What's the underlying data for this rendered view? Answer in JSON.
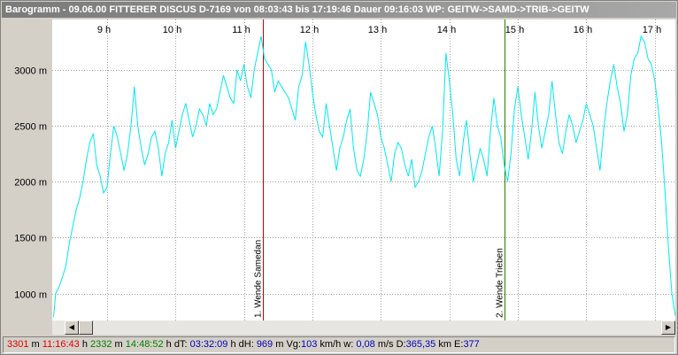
{
  "window": {
    "title": "Barogramm - 09.06.00 FITTERER DISCUS D-7169 von 08:03:43 bis 17:19:46 Dauer 09:16:03 WP: GEITW->SAMD->TRIB->GEITW"
  },
  "colors": {
    "trace": "#00e8ee",
    "marker1": "#cc0000",
    "marker2": "#2e7d00",
    "grid": "#a0a0a0",
    "plot_bg": "#ffffff"
  },
  "chart_data": {
    "type": "line",
    "title": "",
    "xlabel": "",
    "ylabel": "",
    "xlim": [
      8.2,
      17.3
    ],
    "ylim": [
      760,
      3450
    ],
    "x_ticks": [
      9,
      10,
      11,
      12,
      13,
      14,
      15,
      16,
      17
    ],
    "x_tick_labels": [
      "9 h",
      "10 h",
      "11 h",
      "12 h",
      "13 h",
      "14 h",
      "15 h",
      "16 h",
      "17 h"
    ],
    "y_ticks": [
      1000,
      1500,
      2000,
      2500,
      3000
    ],
    "y_tick_labels": [
      "1000 m",
      "1500 m",
      "2000 m",
      "2500 m",
      "3000 m"
    ],
    "grid": true,
    "series": [
      {
        "x": [
          8.22,
          8.25,
          8.3,
          8.35,
          8.4,
          8.45,
          8.5,
          8.55,
          8.6,
          8.65,
          8.7,
          8.75,
          8.8,
          8.85,
          8.9,
          8.95,
          9.0,
          9.05,
          9.1,
          9.15,
          9.2,
          9.25,
          9.3,
          9.35,
          9.4,
          9.45,
          9.5,
          9.55,
          9.6,
          9.65,
          9.7,
          9.75,
          9.8,
          9.85,
          9.9,
          9.95,
          10.0,
          10.05,
          10.1,
          10.15,
          10.2,
          10.25,
          10.3,
          10.35,
          10.4,
          10.45,
          10.5,
          10.55,
          10.6,
          10.65,
          10.7,
          10.75,
          10.8,
          10.85,
          10.9,
          10.95,
          11.0,
          11.05,
          11.1,
          11.15,
          11.2,
          11.25,
          11.3,
          11.35,
          11.4,
          11.45,
          11.5,
          11.55,
          11.6,
          11.65,
          11.7,
          11.75,
          11.8,
          11.85,
          11.9,
          11.95,
          12.0,
          12.05,
          12.1,
          12.15,
          12.2,
          12.25,
          12.3,
          12.35,
          12.4,
          12.45,
          12.5,
          12.55,
          12.6,
          12.65,
          12.7,
          12.75,
          12.8,
          12.85,
          12.9,
          12.95,
          13.0,
          13.05,
          13.1,
          13.15,
          13.2,
          13.25,
          13.3,
          13.35,
          13.4,
          13.45,
          13.5,
          13.55,
          13.6,
          13.65,
          13.7,
          13.75,
          13.8,
          13.85,
          13.9,
          13.95,
          14.0,
          14.05,
          14.1,
          14.15,
          14.2,
          14.25,
          14.3,
          14.35,
          14.4,
          14.45,
          14.5,
          14.55,
          14.6,
          14.65,
          14.7,
          14.75,
          14.8,
          14.85,
          14.9,
          14.95,
          15.0,
          15.05,
          15.1,
          15.15,
          15.2,
          15.25,
          15.3,
          15.35,
          15.4,
          15.45,
          15.5,
          15.55,
          15.6,
          15.65,
          15.7,
          15.75,
          15.8,
          15.85,
          15.9,
          15.95,
          16.0,
          16.05,
          16.1,
          16.15,
          16.2,
          16.25,
          16.3,
          16.35,
          16.4,
          16.45,
          16.5,
          16.55,
          16.6,
          16.65,
          16.7,
          16.75,
          16.8,
          16.85,
          16.9,
          16.95,
          17.0,
          17.05,
          17.1,
          17.15,
          17.2,
          17.25,
          17.3
        ],
        "y": [
          790,
          1000,
          1060,
          1150,
          1250,
          1450,
          1600,
          1750,
          1850,
          2000,
          2200,
          2350,
          2430,
          2150,
          2050,
          1900,
          1950,
          2250,
          2500,
          2400,
          2250,
          2100,
          2250,
          2500,
          2850,
          2500,
          2300,
          2150,
          2250,
          2400,
          2450,
          2300,
          2050,
          2250,
          2350,
          2550,
          2300,
          2450,
          2600,
          2700,
          2550,
          2400,
          2500,
          2650,
          2600,
          2500,
          2700,
          2600,
          2650,
          2800,
          2950,
          2850,
          2750,
          2700,
          3000,
          2900,
          3050,
          2850,
          2750,
          3000,
          3150,
          3300,
          3100,
          3050,
          3000,
          2800,
          2900,
          2850,
          2800,
          2750,
          2650,
          2550,
          2850,
          2950,
          3250,
          3050,
          2800,
          2600,
          2450,
          2400,
          2700,
          2500,
          2300,
          2100,
          2300,
          2400,
          2550,
          2650,
          2300,
          2100,
          2050,
          2200,
          2450,
          2800,
          2700,
          2600,
          2400,
          2300,
          2150,
          2000,
          2250,
          2350,
          2300,
          2150,
          2050,
          2200,
          1950,
          2000,
          2100,
          2250,
          2400,
          2500,
          2300,
          2050,
          2450,
          3150,
          2900,
          2600,
          2200,
          2050,
          2350,
          2550,
          2250,
          2000,
          2150,
          2300,
          2200,
          2050,
          2450,
          2750,
          2500,
          2400,
          2150,
          2000,
          2250,
          2650,
          2850,
          2600,
          2400,
          2200,
          2450,
          2800,
          2500,
          2300,
          2450,
          2600,
          2900,
          2600,
          2350,
          2250,
          2450,
          2600,
          2500,
          2350,
          2450,
          2550,
          2700,
          2600,
          2500,
          2300,
          2100,
          2450,
          2700,
          2900,
          3050,
          2850,
          2700,
          2450,
          2600,
          2950,
          3100,
          3150,
          3300,
          3250,
          3100,
          3050,
          2900,
          2650,
          2350,
          1900,
          1400,
          1000,
          800
        ]
      }
    ],
    "markers": [
      {
        "x": 11.28,
        "label": "1. Wende Samedan",
        "color": "#cc0000"
      },
      {
        "x": 14.81,
        "label": "2. Wende Trieben",
        "color": "#2e7d00"
      }
    ]
  },
  "status": {
    "alt1": "3301",
    "unit_m": " m ",
    "time1": "11:16:43",
    "unit_h": " h ",
    "alt2": "2332",
    "time2": "14:48:52",
    "dT_label": "dT: ",
    "dT": "03:32:09",
    "dH_label": " h dH: ",
    "dH": "969",
    "vg_label": " m Vg:",
    "vg": "103",
    "vg_unit": " km/h w: ",
    "w": "0,08",
    "w_unit": " m/s D:",
    "d": "365,35",
    "d_unit": " km E:",
    "e": "377"
  }
}
